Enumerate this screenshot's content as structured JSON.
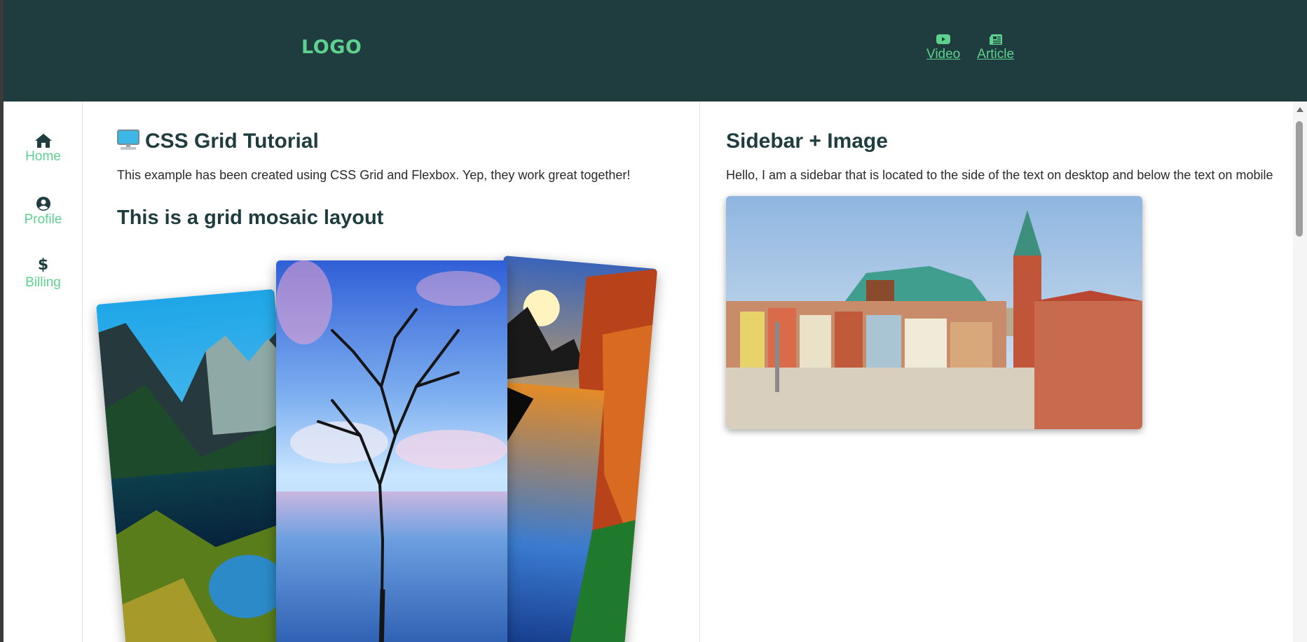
{
  "header": {
    "logo": "LOGO",
    "links": [
      {
        "label": "Video",
        "icon": "youtube-icon"
      },
      {
        "label": "Article",
        "icon": "newspaper-icon"
      }
    ]
  },
  "sidebar": {
    "items": [
      {
        "label": "Home",
        "icon": "home-icon"
      },
      {
        "label": "Profile",
        "icon": "user-circle-icon"
      },
      {
        "label": "Billing",
        "icon": "dollar-icon"
      }
    ]
  },
  "main": {
    "title": "CSS Grid Tutorial",
    "title_icon": "desktop-computer-icon",
    "lead": "This example has been created using CSS Grid and Flexbox. Yep, they work great together!",
    "subtitle": "This is a grid mosaic layout",
    "images": [
      "mountain-lake-image",
      "dead-tree-sea-image",
      "sunset-river-image"
    ]
  },
  "aside": {
    "title": "Sidebar + Image",
    "text": "Hello, I am a sidebar that is located to the side of the text on desktop and below the text on mobile",
    "image": "old-town-square-image"
  },
  "colors": {
    "header_bg": "#1f3d3f",
    "accent": "#5fd18f",
    "heading": "#1f3d3f"
  }
}
